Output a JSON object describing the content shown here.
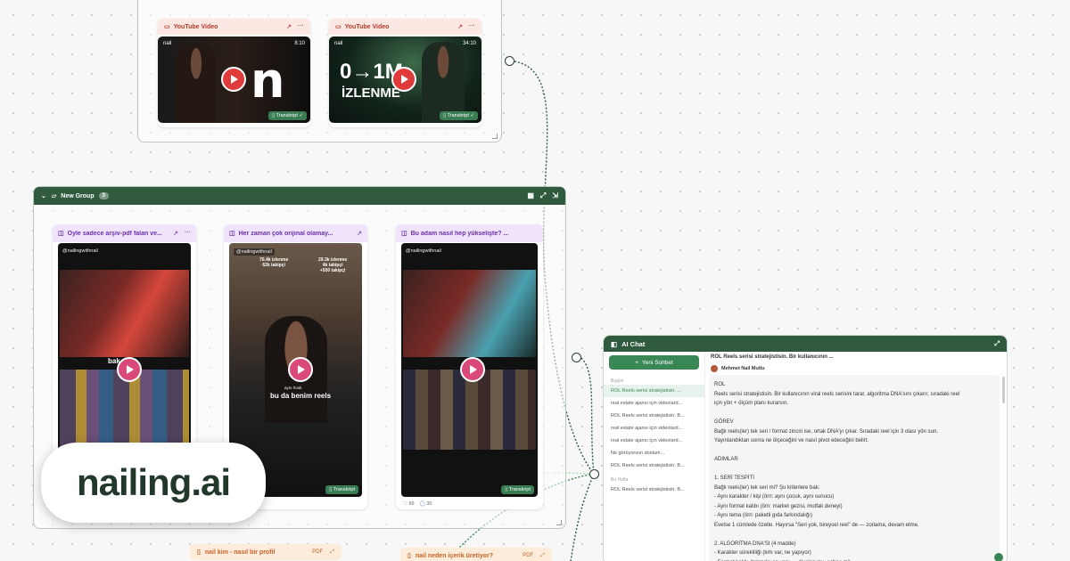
{
  "top_group": {
    "cards": [
      {
        "type_label": "YouTube Video",
        "channel": "nail",
        "duration": "8:10",
        "transcript": "Transkript"
      },
      {
        "type_label": "YouTube Video",
        "channel": "nail",
        "duration": "34:10",
        "transcript": "Transkript",
        "thumb_text": "0→1M",
        "thumb_sub": "İZLENME"
      }
    ]
  },
  "group": {
    "name": "New Group",
    "count": "3",
    "reels": [
      {
        "title": "Öyle sadece arşiv-pdf falan ve...",
        "handle": "@nailingwithnail",
        "overlay": "bak"
      },
      {
        "title": "Her zaman çok orijinal olamay...",
        "handle": "@nailingwithnail",
        "overlay": "bu da benim reels",
        "overlay_small": "aynı hook",
        "stat1": "70.4k izlenme\n62k takipçi",
        "stat2": "29.3k izlenme\n4k takipçi\n+500 takipçi",
        "transcript": "Transkript"
      },
      {
        "title": "Bu adam nasıl hep yükselişte? ...",
        "handle": "@nailingwithnail",
        "transcript": "Transkript",
        "likes": "66",
        "comments": "30"
      }
    ]
  },
  "pdfs": [
    {
      "title": "nail kim - nasıl bir profil",
      "kind": "PDF"
    },
    {
      "title": "nail neden içerik üretiyor?",
      "kind": "PDF"
    }
  ],
  "chat": {
    "header": "AI Chat",
    "new_chat": "Yeni Sohbet",
    "section_today": "Bugün",
    "section_week": "Bu Hafta",
    "sessions_today": [
      "ROL Reels serisi stratejistisin. ...",
      "real estate ajansı için videolard...",
      "ROL Reels serisi stratejistisin. B...",
      "real estate ajansı için videolard...",
      "real estate ajansı için videolard...",
      "Ne görüyorsun dostum...",
      "ROL Reels serisi stratejistisin. B..."
    ],
    "sessions_week": [
      "ROL Reels serisi stratejistisin. B..."
    ],
    "conversation_title": "ROL Reels serisi stratejistisin. Bir kullanıcının ...",
    "author": "Mehmet Nail Mutlu",
    "message_lines": [
      "ROL",
      "Reels serisi stratejistisin. Bir kullanıcının viral reels serisini tarar, algoritma DNA'sını çıkarır, sıradaki reel",
      "için yön + ölçüm planı kurarsın.",
      "",
      "GÖREV",
      "Bağlı reels(ler) tek seri / format zinciri ise, ortak DNA'yı çıkar. Sıradaki reel için 3 olası yön sun.",
      "Yayınlandıktan sonra ne ölçeceğini ve nasıl pivot edeceğini belirt.",
      "",
      "ADIMLAR",
      "",
      "1. SERİ TESPİTİ",
      "Bağlı reels(ler) tek seri mi? Şu kriterlere bak:",
      "- Aynı karakter / kişi (örn: aynı çocuk, aynı sunucu)",
      "- Aynı format kalıbı (örn: market gezisi, mutfak deneyi)",
      "- Aynı tema (örn: paketli gıda farkındalığı)",
      "Evetse 1 cümlede özetle. Hayırsa \"Seri yok, bireysel reel\" de — zorlama, devam etme.",
      "",
      "2. ALGORİTMA DNA'SI (4 madde)",
      "- Karakter sürekliliği (kim var, ne yapıyor)",
      "- Format kalıbı (tekrarlayan yapı — diyalog mu, sahne mi)"
    ]
  },
  "logo": {
    "text": "nailing.ai"
  },
  "colors": {
    "brand_green": "#2f5a3d",
    "accent_green": "#3a8756",
    "yt_red": "#e03b3b",
    "reel_purple": "#6c2fa8",
    "pdf_orange": "#c0632a"
  }
}
